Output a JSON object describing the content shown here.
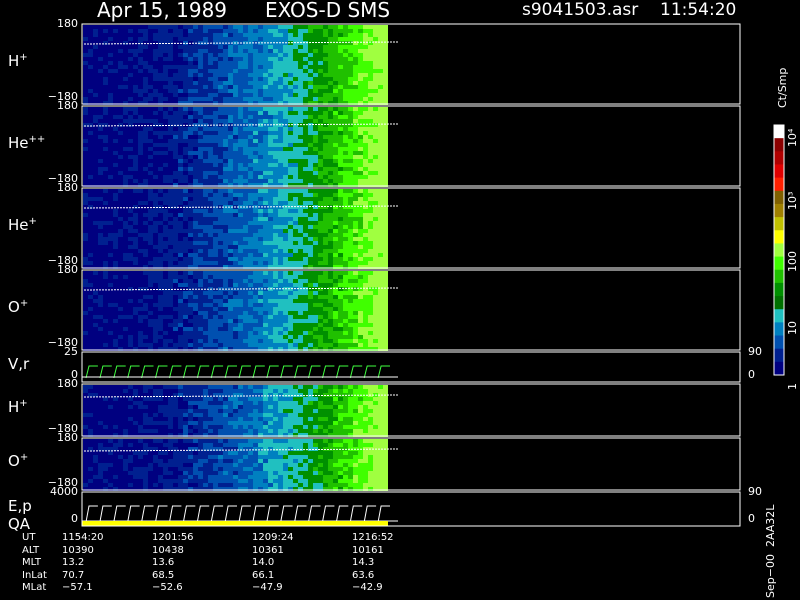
{
  "header": {
    "date": "Apr 15, 1989",
    "instrument": "EXOS-D SMS",
    "file": "s9041503.asr",
    "time": "11:54:20"
  },
  "panels": [
    {
      "label": "H",
      "sup": "+",
      "top_tick": "180",
      "bottom_tick": "−180"
    },
    {
      "label": "He",
      "sup": "++",
      "top_tick": "180",
      "bottom_tick": "−180"
    },
    {
      "label": "He",
      "sup": "+",
      "top_tick": "180",
      "bottom_tick": "−180"
    },
    {
      "label": "O",
      "sup": "+",
      "top_tick": "180",
      "bottom_tick": "−180"
    },
    {
      "label": "V,r",
      "sup": "",
      "top_tick": "25",
      "bottom_tick": "0",
      "right_top": "90",
      "right_bottom": "0"
    },
    {
      "label": "H",
      "sup": "+",
      "top_tick": "180",
      "bottom_tick": "−180"
    },
    {
      "label": "O",
      "sup": "+",
      "top_tick": "180",
      "bottom_tick": "−180"
    },
    {
      "label": "E,p",
      "label2": "QA",
      "sup": "",
      "top_tick": "4000",
      "bottom_tick": "0",
      "right_top": "90",
      "right_bottom": "0"
    }
  ],
  "colorbar": {
    "unit": "Ct/Smp",
    "labels": [
      "10⁴",
      "10³",
      "100",
      "10",
      "1"
    ],
    "colors": [
      "#ffffff",
      "#8b0000",
      "#b00000",
      "#e00000",
      "#ff2000",
      "#806000",
      "#a08000",
      "#c0c000",
      "#ffff00",
      "#a0ff40",
      "#40ff00",
      "#20c000",
      "#009000",
      "#007000",
      "#20c0c0",
      "#0080c0",
      "#0050b0",
      "#002090",
      "#000080"
    ]
  },
  "orbit": {
    "rows": [
      {
        "name": "UT",
        "values": [
          "1154:20",
          "1201:56",
          "1209:24",
          "1216:52"
        ]
      },
      {
        "name": "ALT",
        "values": [
          "10390",
          "10438",
          "10361",
          "10161"
        ]
      },
      {
        "name": "MLT",
        "values": [
          "13.2",
          "13.6",
          "14.0",
          "14.3"
        ]
      },
      {
        "name": "InLat",
        "values": [
          "70.7",
          "68.5",
          "66.1",
          "63.6"
        ]
      },
      {
        "name": "MLat",
        "values": [
          "−57.1",
          "−52.6",
          "−47.9",
          "−42.9"
        ]
      }
    ]
  },
  "footer_vertical": "Sep−00  2AA32L",
  "chart_data": {
    "type": "heatmap",
    "title": "Apr 15, 1989    EXOS-D SMS",
    "xlabel": "UT",
    "x_ticks": [
      "1154:20",
      "1201:56",
      "1209:24",
      "1216:52"
    ],
    "series": [
      {
        "name": "H+",
        "ylim": [
          -180,
          180
        ]
      },
      {
        "name": "He++",
        "ylim": [
          -180,
          180
        ]
      },
      {
        "name": "He+",
        "ylim": [
          -180,
          180
        ]
      },
      {
        "name": "O+",
        "ylim": [
          -180,
          180
        ]
      },
      {
        "name": "V,r",
        "ylim": [
          0,
          25
        ],
        "right_ylim": [
          0,
          90
        ]
      },
      {
        "name": "H+",
        "ylim": [
          -180,
          180
        ]
      },
      {
        "name": "O+",
        "ylim": [
          -180,
          180
        ]
      },
      {
        "name": "E,p QA",
        "ylim": [
          0,
          4000
        ],
        "right_ylim": [
          0,
          90
        ]
      }
    ],
    "color_scale": "log",
    "color_range": [
      1,
      10000
    ],
    "color_unit": "Ct/Smp"
  }
}
